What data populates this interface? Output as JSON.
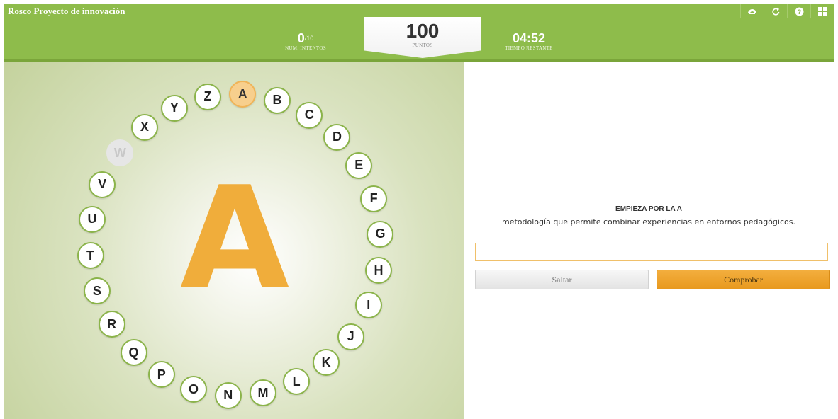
{
  "app": {
    "title": "Rosco Proyecto de innovación"
  },
  "toolbar": {
    "icons": [
      "rosco-icon",
      "restart-icon",
      "help-icon",
      "grid-icon"
    ]
  },
  "stats": {
    "attempts": {
      "value": "0",
      "total": "/10",
      "label": "NUM. INTENTOS"
    },
    "points": {
      "value": "100",
      "label": "PUNTOS"
    },
    "time": {
      "value": "04:52",
      "label": "TIEMPO RESTANTE"
    }
  },
  "current_letter": "A",
  "letters": [
    {
      "letter": "A",
      "state": "current"
    },
    {
      "letter": "B",
      "state": "pending"
    },
    {
      "letter": "C",
      "state": "pending"
    },
    {
      "letter": "D",
      "state": "pending"
    },
    {
      "letter": "E",
      "state": "pending"
    },
    {
      "letter": "F",
      "state": "pending"
    },
    {
      "letter": "G",
      "state": "pending"
    },
    {
      "letter": "H",
      "state": "pending"
    },
    {
      "letter": "I",
      "state": "pending"
    },
    {
      "letter": "J",
      "state": "pending"
    },
    {
      "letter": "K",
      "state": "pending"
    },
    {
      "letter": "L",
      "state": "pending"
    },
    {
      "letter": "M",
      "state": "pending"
    },
    {
      "letter": "N",
      "state": "pending"
    },
    {
      "letter": "O",
      "state": "pending"
    },
    {
      "letter": "P",
      "state": "pending"
    },
    {
      "letter": "Q",
      "state": "pending"
    },
    {
      "letter": "R",
      "state": "pending"
    },
    {
      "letter": "S",
      "state": "pending"
    },
    {
      "letter": "T",
      "state": "pending"
    },
    {
      "letter": "U",
      "state": "pending"
    },
    {
      "letter": "V",
      "state": "pending"
    },
    {
      "letter": "W",
      "state": "skipped"
    },
    {
      "letter": "X",
      "state": "pending"
    },
    {
      "letter": "Y",
      "state": "pending"
    },
    {
      "letter": "Z",
      "state": "pending"
    }
  ],
  "question": {
    "heading": "EMPIEZA POR LA A",
    "text": "metodología que permite combinar experiencias en entornos pedagógicos."
  },
  "answer": {
    "value": "",
    "placeholder": ""
  },
  "buttons": {
    "skip": "Saltar",
    "check": "Comprobar"
  },
  "colors": {
    "header_green": "#8ebc4b",
    "ring_border": "#8bb44a",
    "accent_orange": "#f0ad3b",
    "current_fill": "#f7cf8d",
    "skipped_fill": "#e6e6e6"
  }
}
